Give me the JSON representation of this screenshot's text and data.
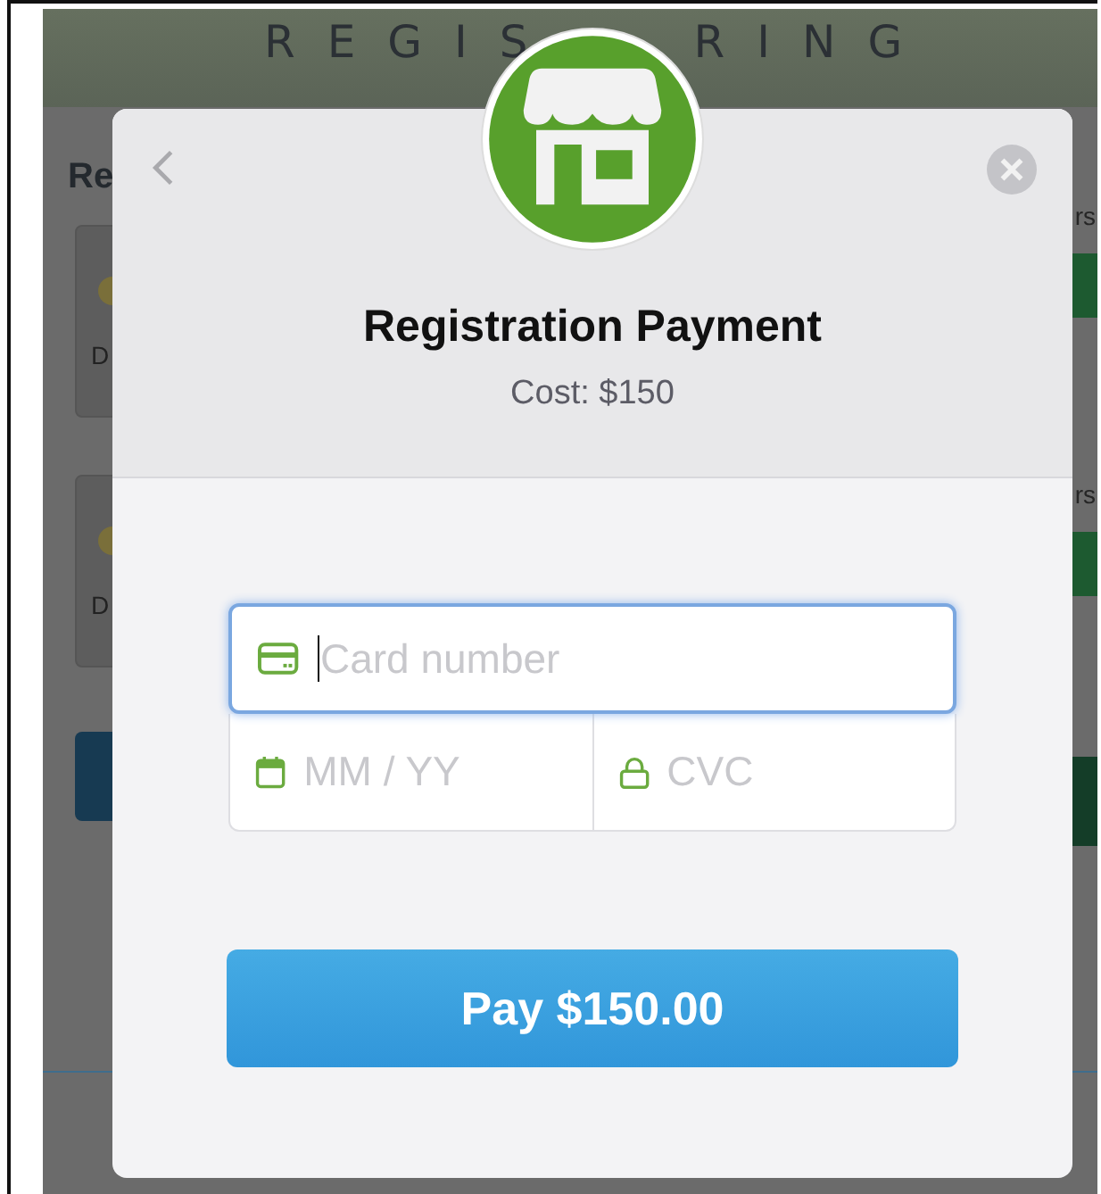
{
  "background_page": {
    "header_title": [
      "REGIS",
      "RING"
    ],
    "heading_fragment": "Re",
    "cards": [
      {
        "text": "D"
      },
      {
        "text": "D"
      }
    ],
    "side_labels": [
      "rs",
      "rs"
    ]
  },
  "dialog": {
    "title": "Registration Payment",
    "subtitle": "Cost: $150",
    "fields": [
      {
        "kind": "card",
        "placeholder": "Card number",
        "focused": true
      },
      {
        "kind": "expiry",
        "placeholder": "MM / YY",
        "focused": false
      },
      {
        "kind": "cvc",
        "placeholder": "CVC",
        "focused": false
      }
    ],
    "pay_button": "Pay $150.00"
  }
}
